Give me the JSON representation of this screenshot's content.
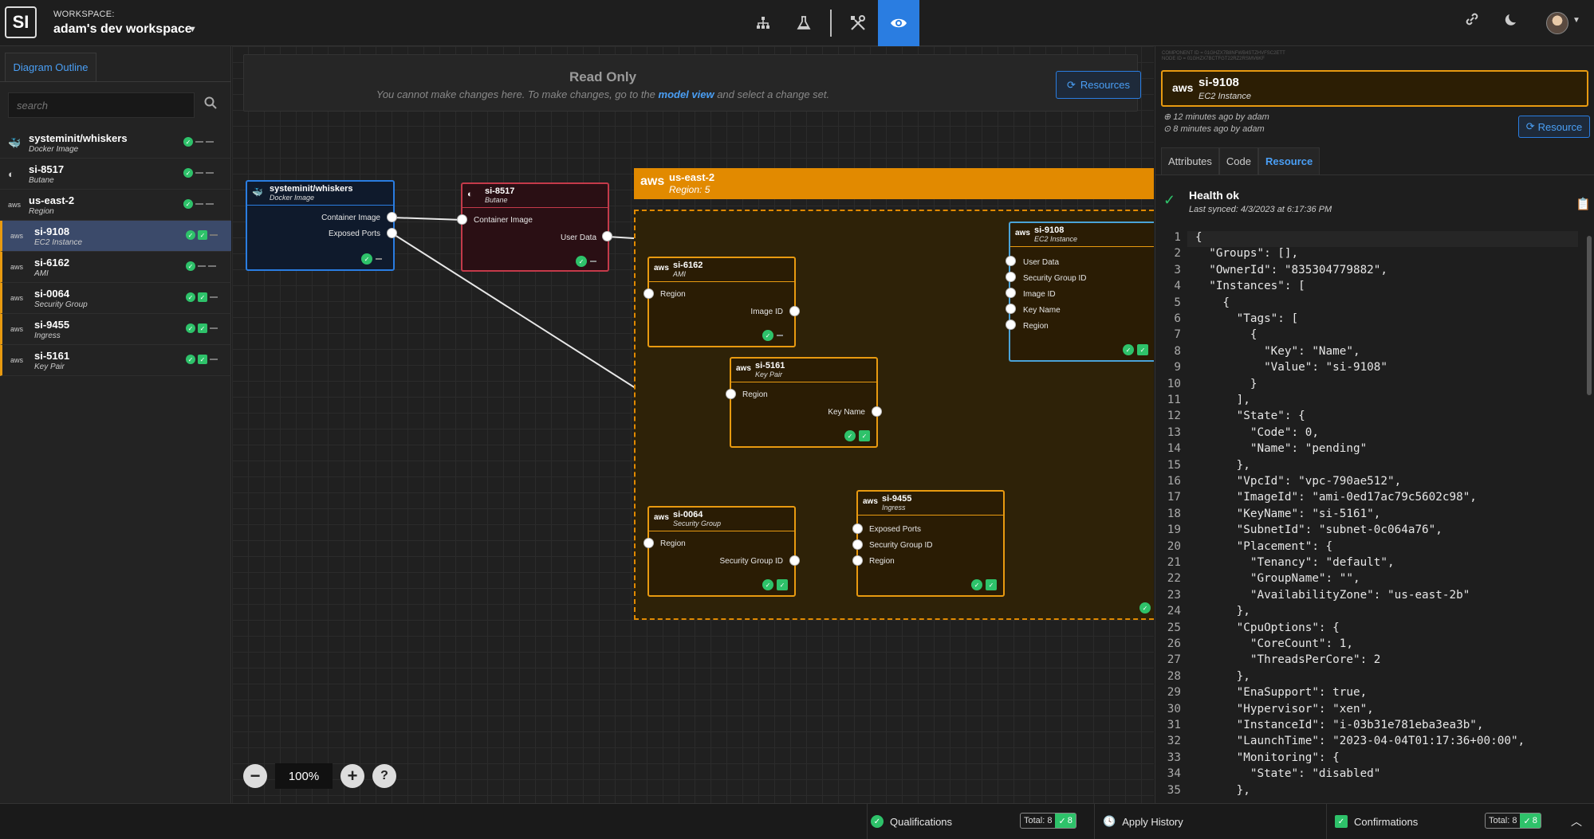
{
  "header": {
    "logo": "SI",
    "workspace_label": "WORKSPACE:",
    "workspace_name": "adam's dev workspace",
    "icons": [
      "hierarchy-icon",
      "flask-icon",
      "tools-icon",
      "eye-icon",
      "link-icon",
      "moon-icon",
      "avatar"
    ]
  },
  "sidebar": {
    "tab": "Diagram Outline",
    "search_placeholder": "search",
    "items": [
      {
        "name": "systeminit/whiskers",
        "type": "Docker Image",
        "icon": "docker-icon"
      },
      {
        "name": "si-8517",
        "type": "Butane",
        "icon": "butane-icon"
      },
      {
        "name": "us-east-2",
        "type": "Region",
        "icon": "aws-icon"
      },
      {
        "name": "si-9108",
        "type": "EC2 Instance",
        "icon": "aws-icon"
      },
      {
        "name": "si-6162",
        "type": "AMI",
        "icon": "aws-icon"
      },
      {
        "name": "si-0064",
        "type": "Security Group",
        "icon": "aws-icon"
      },
      {
        "name": "si-9455",
        "type": "Ingress",
        "icon": "aws-icon"
      },
      {
        "name": "si-5161",
        "type": "Key Pair",
        "icon": "aws-icon"
      }
    ]
  },
  "banner": {
    "title": "Read Only",
    "text_before": "You cannot make changes here. To make changes, go to the ",
    "link": "model view",
    "text_after": " and select a change set.",
    "resources_button": "Resources"
  },
  "diagram": {
    "aws_label": "aws",
    "nodes": {
      "whiskers": {
        "name": "systeminit/whiskers",
        "type": "Docker Image",
        "s1": "Container Image",
        "s2": "Exposed Ports"
      },
      "butane": {
        "name": "si-8517",
        "type": "Butane",
        "s1": "Container Image",
        "s2": "User Data"
      },
      "region": {
        "name": "us-east-2",
        "type": "Region: 5"
      },
      "ami": {
        "name": "si-6162",
        "type": "AMI",
        "s1": "Region",
        "s2": "Image ID"
      },
      "ec2": {
        "name": "si-9108",
        "type": "EC2 Instance",
        "s1": "User Data",
        "s2": "Security Group ID",
        "s3": "Image ID",
        "s4": "Key Name",
        "s5": "Region"
      },
      "keypair": {
        "name": "si-5161",
        "type": "Key Pair",
        "s1": "Region",
        "s2": "Key Name"
      },
      "sg": {
        "name": "si-0064",
        "type": "Security Group",
        "s1": "Region",
        "s2": "Security Group ID"
      },
      "ingress": {
        "name": "si-9455",
        "type": "Ingress",
        "s1": "Exposed Ports",
        "s2": "Security Group ID",
        "s3": "Region"
      }
    },
    "zoom": "100%"
  },
  "panel": {
    "meta1": "COMPONENT ID = 01GHZX7B8NFWB4STZHVFSC2ETT",
    "meta2": "NODE ID = 01GHZX7BCTFGT22RZ2RSMV6KF",
    "name": "si-9108",
    "type": "EC2 Instance",
    "history1": "12 minutes ago by adam",
    "history2": "8 minutes ago by adam",
    "resource_button": "Resource",
    "tabs": [
      "Attributes",
      "Code",
      "Resource"
    ],
    "health_title": "Health ok",
    "health_sync": "Last synced: 4/3/2023 at 6:17:36 PM",
    "code_lines": [
      "{",
      "  \"Groups\": [],",
      "  \"OwnerId\": \"835304779882\",",
      "  \"Instances\": [",
      "    {",
      "      \"Tags\": [",
      "        {",
      "          \"Key\": \"Name\",",
      "          \"Value\": \"si-9108\"",
      "        }",
      "      ],",
      "      \"State\": {",
      "        \"Code\": 0,",
      "        \"Name\": \"pending\"",
      "      },",
      "      \"VpcId\": \"vpc-790ae512\",",
      "      \"ImageId\": \"ami-0ed17ac79c5602c98\",",
      "      \"KeyName\": \"si-5161\",",
      "      \"SubnetId\": \"subnet-0c064a76\",",
      "      \"Placement\": {",
      "        \"Tenancy\": \"default\",",
      "        \"GroupName\": \"\",",
      "        \"AvailabilityZone\": \"us-east-2b\"",
      "      },",
      "      \"CpuOptions\": {",
      "        \"CoreCount\": 1,",
      "        \"ThreadsPerCore\": 2",
      "      },",
      "      \"EnaSupport\": true,",
      "      \"Hypervisor\": \"xen\",",
      "      \"InstanceId\": \"i-03b31e781eba3ea3b\",",
      "      \"LaunchTime\": \"2023-04-04T01:17:36+00:00\",",
      "      \"Monitoring\": {",
      "        \"State\": \"disabled\"",
      "      },"
    ]
  },
  "statusbar": {
    "qualifications": "Qualifications",
    "qual_total": "Total: 8",
    "qual_ok": "8",
    "apply_history": "Apply History",
    "confirmations": "Confirmations",
    "conf_total": "Total: 8",
    "conf_ok": "8"
  },
  "colors": {
    "accent": "#2a7de1",
    "aws_orange": "#e28a00",
    "ok_green": "#2ec26a"
  }
}
